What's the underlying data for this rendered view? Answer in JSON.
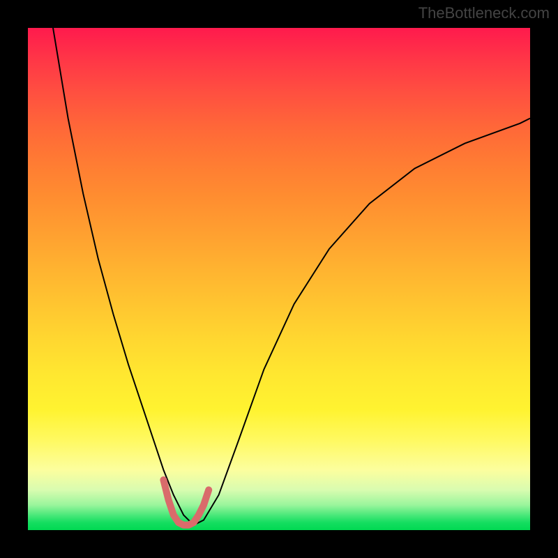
{
  "watermark": "TheBottleneck.com",
  "chart_data": {
    "type": "line",
    "title": "",
    "xlabel": "",
    "ylabel": "",
    "xlim": [
      0,
      100
    ],
    "ylim": [
      0,
      100
    ],
    "background_gradient": {
      "type": "vertical",
      "stops": [
        {
          "pos": 0,
          "color": "#ff1a4d"
        },
        {
          "pos": 50,
          "color": "#ffc530"
        },
        {
          "pos": 88,
          "color": "#fcfe9e"
        },
        {
          "pos": 100,
          "color": "#00d952"
        }
      ]
    },
    "series": [
      {
        "name": "main-curve",
        "color": "#000000",
        "stroke_width": 2,
        "x": [
          5,
          8,
          11,
          14,
          17,
          20,
          23,
          25,
          27,
          29,
          31,
          33,
          35,
          38,
          42,
          47,
          53,
          60,
          68,
          77,
          87,
          98,
          100
        ],
        "y": [
          100,
          82,
          67,
          54,
          43,
          33,
          24,
          18,
          12,
          7,
          3,
          1,
          2,
          7,
          18,
          32,
          45,
          56,
          65,
          72,
          77,
          81,
          82
        ]
      },
      {
        "name": "highlight-segment",
        "color": "#d96b6b",
        "stroke_width": 10,
        "x": [
          27,
          28,
          29,
          30,
          31,
          32,
          33,
          34,
          35,
          36
        ],
        "y": [
          10,
          6,
          3,
          1.5,
          1,
          1,
          1.5,
          3,
          5,
          8
        ]
      }
    ]
  }
}
